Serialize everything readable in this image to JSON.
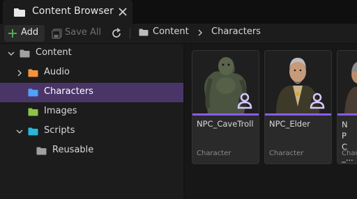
{
  "tab": {
    "title": "Content Browser"
  },
  "toolbar": {
    "add_label": "Add",
    "save_all_label": "Save All"
  },
  "breadcrumb": {
    "items": [
      "Content",
      "Characters"
    ]
  },
  "tree": {
    "items": [
      {
        "label": "Content",
        "folder_color": "#a0a0a0",
        "expanded": true
      },
      {
        "label": "Audio",
        "folder_color": "#f5923e",
        "expanded": false
      },
      {
        "label": "Characters",
        "folder_color": "#4ea1ff",
        "selected": true
      },
      {
        "label": "Images",
        "folder_color": "#8bc34a"
      },
      {
        "label": "Scripts",
        "folder_color": "#29b6d8",
        "expanded": true
      },
      {
        "label": "Reusable",
        "folder_color": "#a0a0a0"
      }
    ]
  },
  "assets": [
    {
      "name": "NPC_CaveTroll",
      "type": "Character"
    },
    {
      "name": "NPC_Elder",
      "type": "Character"
    },
    {
      "name": "NPC_...t",
      "type": "Character"
    }
  ],
  "colors": {
    "selection": "#4a3569",
    "accent": "#8b5cf6",
    "add_plus": "#4caf50"
  }
}
